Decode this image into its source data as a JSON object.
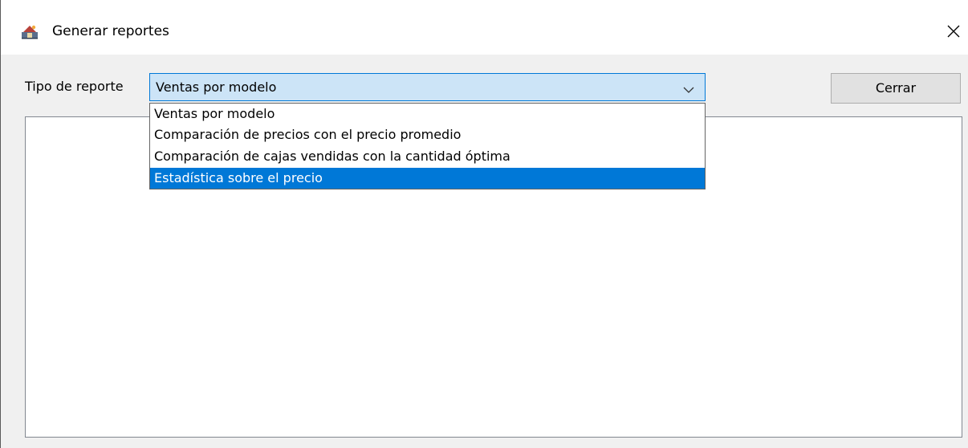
{
  "window": {
    "title": "Generar reportes",
    "icon": "java-app-icon",
    "close_icon": "close-icon"
  },
  "form": {
    "report_type_label": "Tipo de reporte",
    "report_type_value": "Ventas por modelo",
    "close_button_label": "Cerrar"
  },
  "dropdown": {
    "options": [
      {
        "label": "Ventas por modelo",
        "highlighted": false
      },
      {
        "label": "Comparación de precios con el precio promedio",
        "highlighted": false
      },
      {
        "label": "Comparación de cajas vendidas con la cantidad óptima",
        "highlighted": false
      },
      {
        "label": "Estadística sobre el precio",
        "highlighted": true
      }
    ]
  },
  "colors": {
    "selection": "#0078d7",
    "combo_background": "#cce4f7",
    "window_background": "#f0f0f0"
  }
}
